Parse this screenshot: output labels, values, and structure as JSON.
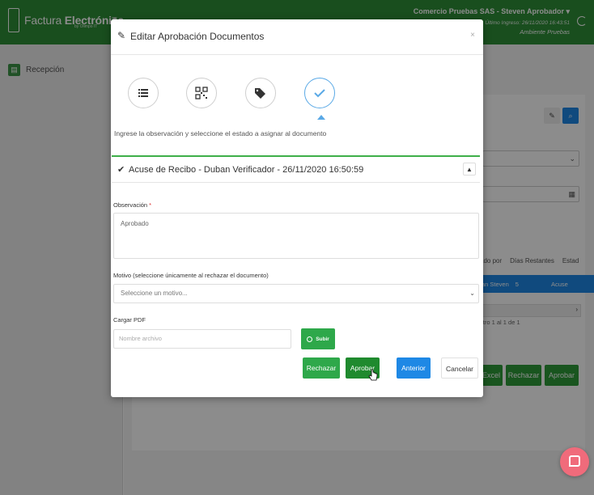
{
  "header": {
    "brand_light": "Factura",
    "brand_bold": "Electrónica",
    "brand_sub": "by Olimpo IT",
    "user": "Comercio Pruebas SAS - Steven Aprobador",
    "last_login": "Último Ingreso: 26/11/2020 16:43:51",
    "environment": "Ambiente Pruebas"
  },
  "sidebar": {
    "items": [
      {
        "label": "Recepción"
      }
    ]
  },
  "background": {
    "table": {
      "headers": [
        "ado por",
        "Días Restantes",
        "Estad"
      ],
      "row": [
        "an Steven",
        "5",
        "Acuse"
      ]
    },
    "pagination": "stro 1 al 1 de 1",
    "buttons": [
      "Excel",
      "Rechazar",
      "Aprobar"
    ]
  },
  "modal": {
    "title": "Editar Aprobación Documentos",
    "instruction": "Ingrese la observación y seleccione el estado a asignar al documento",
    "steps": [
      {
        "icon": "list-icon"
      },
      {
        "icon": "qr-code-icon"
      },
      {
        "icon": "tags-icon"
      },
      {
        "icon": "check-icon"
      }
    ],
    "panel_title": "Acuse de Recibo - Duban Verificador - 26/11/2020 16:50:59",
    "observation": {
      "label": "Observación",
      "required_mark": "*",
      "value": "Aprobado"
    },
    "reason": {
      "label": "Motivo (seleccione únicamente al rechazar el documento)",
      "placeholder": "Seleccione un motivo..."
    },
    "pdf": {
      "label": "Cargar PDF",
      "placeholder": "Nombre archivo",
      "upload_label": "Subir"
    },
    "buttons": {
      "reject": "Rechazar",
      "approve": "Aprobar",
      "previous": "Anterior",
      "cancel": "Cancelar"
    }
  },
  "colors": {
    "brand_green": "#2e8f38",
    "button_green": "#2ea84a",
    "primary_blue": "#1e88e5",
    "chat_pink": "#f06b7b"
  }
}
